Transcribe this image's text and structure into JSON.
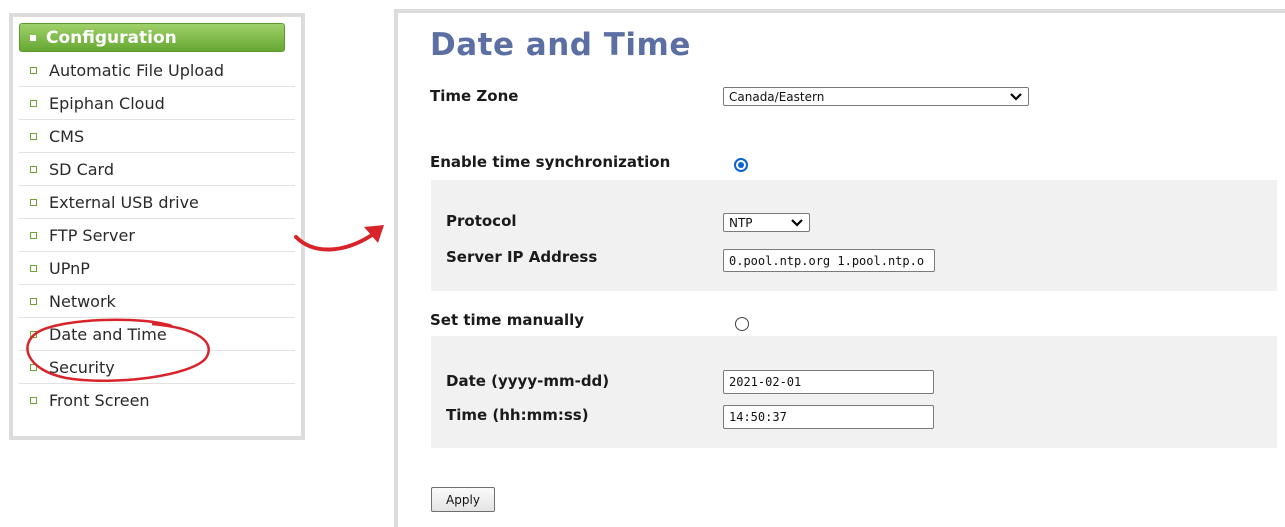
{
  "sidebar": {
    "header": "Configuration",
    "items": [
      {
        "label": "Automatic File Upload"
      },
      {
        "label": "Epiphan Cloud"
      },
      {
        "label": "CMS"
      },
      {
        "label": "SD Card"
      },
      {
        "label": "External USB drive"
      },
      {
        "label": "FTP Server"
      },
      {
        "label": "UPnP"
      },
      {
        "label": "Network"
      },
      {
        "label": "Date and Time"
      },
      {
        "label": "Security"
      },
      {
        "label": "Front Screen"
      }
    ]
  },
  "main": {
    "title": "Date and Time",
    "time_zone": {
      "label": "Time Zone",
      "value": "Canada/Eastern"
    },
    "sync": {
      "label": "Enable time synchronization",
      "selected": true,
      "protocol": {
        "label": "Protocol",
        "value": "NTP"
      },
      "server": {
        "label": "Server IP Address",
        "value": "0.pool.ntp.org 1.pool.ntp.o"
      }
    },
    "manual": {
      "label": "Set time manually",
      "selected": false,
      "date": {
        "label": "Date (yyyy-mm-dd)",
        "value": "2021-02-01"
      },
      "time": {
        "label": "Time (hh:mm:ss)",
        "value": "14:50:37"
      }
    },
    "apply_label": "Apply"
  },
  "annotation_color": "#d8232a",
  "accent_color": "#66a832",
  "title_color": "#5b6fa3"
}
